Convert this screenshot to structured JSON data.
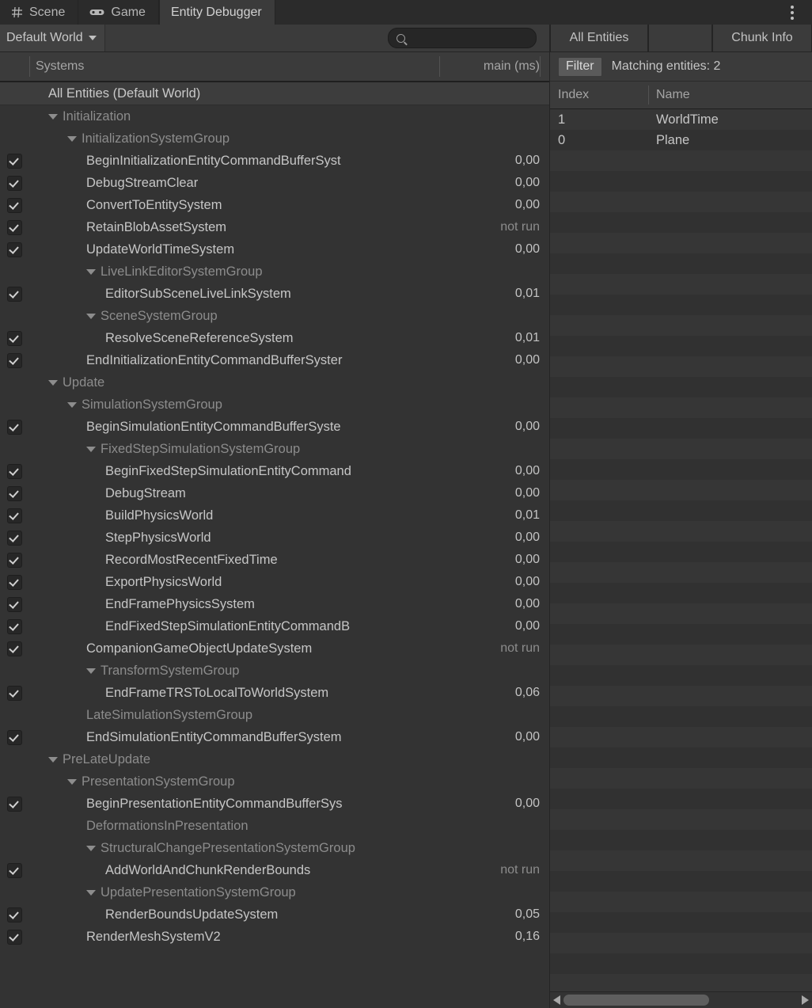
{
  "window": {
    "tabs": [
      {
        "label": "Scene",
        "icon": "grid-icon",
        "active": false
      },
      {
        "label": "Game",
        "icon": "gamepad-icon",
        "active": false
      },
      {
        "label": "Entity Debugger",
        "icon": "none",
        "active": true
      }
    ],
    "menu_icon": "kebab-menu-icon"
  },
  "toolbar": {
    "world_selector": "Default World",
    "world_caret": "chevron-down-icon",
    "search_placeholder": "",
    "search_value": "",
    "search_icon": "search-icon",
    "segments": [
      {
        "label": "All Entities"
      },
      {
        "label": ""
      },
      {
        "label": "Chunk Info"
      }
    ]
  },
  "systems_panel": {
    "columns": {
      "name": "Systems",
      "time": "main (ms)"
    },
    "rows": [
      {
        "indent": 1,
        "label": "All Entities (Default World)",
        "kind": "root",
        "triangle": false,
        "checkbox": false,
        "time": "",
        "highlight": true
      },
      {
        "indent": 1,
        "label": "Initialization",
        "kind": "group",
        "triangle": true,
        "checkbox": false,
        "time": "",
        "highlight": false
      },
      {
        "indent": 2,
        "label": "InitializationSystemGroup",
        "kind": "group",
        "triangle": true,
        "checkbox": false,
        "time": "",
        "highlight": false
      },
      {
        "indent": 3,
        "label": "BeginInitializationEntityCommandBufferSyst",
        "kind": "system",
        "triangle": false,
        "checkbox": true,
        "time": "0,00",
        "highlight": false
      },
      {
        "indent": 3,
        "label": "DebugStreamClear",
        "kind": "system",
        "triangle": false,
        "checkbox": true,
        "time": "0,00",
        "highlight": false
      },
      {
        "indent": 3,
        "label": "ConvertToEntitySystem",
        "kind": "system",
        "triangle": false,
        "checkbox": true,
        "time": "0,00",
        "highlight": false
      },
      {
        "indent": 3,
        "label": "RetainBlobAssetSystem",
        "kind": "system",
        "triangle": false,
        "checkbox": true,
        "time": "not run",
        "highlight": false
      },
      {
        "indent": 3,
        "label": "UpdateWorldTimeSystem",
        "kind": "system",
        "triangle": false,
        "checkbox": true,
        "time": "0,00",
        "highlight": false
      },
      {
        "indent": 3,
        "label": "LiveLinkEditorSystemGroup",
        "kind": "group",
        "triangle": true,
        "checkbox": false,
        "time": "",
        "highlight": false
      },
      {
        "indent": 4,
        "label": "EditorSubSceneLiveLinkSystem",
        "kind": "system",
        "triangle": false,
        "checkbox": true,
        "time": "0,01",
        "highlight": false
      },
      {
        "indent": 3,
        "label": "SceneSystemGroup",
        "kind": "group",
        "triangle": true,
        "checkbox": false,
        "time": "",
        "highlight": false
      },
      {
        "indent": 4,
        "label": "ResolveSceneReferenceSystem",
        "kind": "system",
        "triangle": false,
        "checkbox": true,
        "time": "0,01",
        "highlight": false
      },
      {
        "indent": 3,
        "label": "EndInitializationEntityCommandBufferSyster",
        "kind": "system",
        "triangle": false,
        "checkbox": true,
        "time": "0,00",
        "highlight": false
      },
      {
        "indent": 1,
        "label": "Update",
        "kind": "group",
        "triangle": true,
        "checkbox": false,
        "time": "",
        "highlight": false
      },
      {
        "indent": 2,
        "label": "SimulationSystemGroup",
        "kind": "group",
        "triangle": true,
        "checkbox": false,
        "time": "",
        "highlight": false
      },
      {
        "indent": 3,
        "label": "BeginSimulationEntityCommandBufferSyste",
        "kind": "system",
        "triangle": false,
        "checkbox": true,
        "time": "0,00",
        "highlight": false
      },
      {
        "indent": 3,
        "label": "FixedStepSimulationSystemGroup",
        "kind": "group",
        "triangle": true,
        "checkbox": false,
        "time": "",
        "highlight": false
      },
      {
        "indent": 4,
        "label": "BeginFixedStepSimulationEntityCommand",
        "kind": "system",
        "triangle": false,
        "checkbox": true,
        "time": "0,00",
        "highlight": false
      },
      {
        "indent": 4,
        "label": "DebugStream",
        "kind": "system",
        "triangle": false,
        "checkbox": true,
        "time": "0,00",
        "highlight": false
      },
      {
        "indent": 4,
        "label": "BuildPhysicsWorld",
        "kind": "system",
        "triangle": false,
        "checkbox": true,
        "time": "0,01",
        "highlight": false
      },
      {
        "indent": 4,
        "label": "StepPhysicsWorld",
        "kind": "system",
        "triangle": false,
        "checkbox": true,
        "time": "0,00",
        "highlight": false
      },
      {
        "indent": 4,
        "label": "RecordMostRecentFixedTime",
        "kind": "system",
        "triangle": false,
        "checkbox": true,
        "time": "0,00",
        "highlight": false
      },
      {
        "indent": 4,
        "label": "ExportPhysicsWorld",
        "kind": "system",
        "triangle": false,
        "checkbox": true,
        "time": "0,00",
        "highlight": false
      },
      {
        "indent": 4,
        "label": "EndFramePhysicsSystem",
        "kind": "system",
        "triangle": false,
        "checkbox": true,
        "time": "0,00",
        "highlight": false
      },
      {
        "indent": 4,
        "label": "EndFixedStepSimulationEntityCommandB",
        "kind": "system",
        "triangle": false,
        "checkbox": true,
        "time": "0,00",
        "highlight": false
      },
      {
        "indent": 3,
        "label": "CompanionGameObjectUpdateSystem",
        "kind": "system",
        "triangle": false,
        "checkbox": true,
        "time": "not run",
        "highlight": false
      },
      {
        "indent": 3,
        "label": "TransformSystemGroup",
        "kind": "group",
        "triangle": true,
        "checkbox": false,
        "time": "",
        "highlight": false
      },
      {
        "indent": 4,
        "label": "EndFrameTRSToLocalToWorldSystem",
        "kind": "system",
        "triangle": false,
        "checkbox": true,
        "time": "0,06",
        "highlight": false
      },
      {
        "indent": 3,
        "label": "LateSimulationSystemGroup",
        "kind": "group",
        "triangle": false,
        "checkbox": false,
        "time": "",
        "highlight": false
      },
      {
        "indent": 3,
        "label": "EndSimulationEntityCommandBufferSystem",
        "kind": "system",
        "triangle": false,
        "checkbox": true,
        "time": "0,00",
        "highlight": false
      },
      {
        "indent": 1,
        "label": "PreLateUpdate",
        "kind": "group",
        "triangle": true,
        "checkbox": false,
        "time": "",
        "highlight": false
      },
      {
        "indent": 2,
        "label": "PresentationSystemGroup",
        "kind": "group",
        "triangle": true,
        "checkbox": false,
        "time": "",
        "highlight": false
      },
      {
        "indent": 3,
        "label": "BeginPresentationEntityCommandBufferSys",
        "kind": "system",
        "triangle": false,
        "checkbox": true,
        "time": "0,00",
        "highlight": false
      },
      {
        "indent": 3,
        "label": "DeformationsInPresentation",
        "kind": "group",
        "triangle": false,
        "checkbox": false,
        "time": "",
        "highlight": false
      },
      {
        "indent": 3,
        "label": "StructuralChangePresentationSystemGroup",
        "kind": "group",
        "triangle": true,
        "checkbox": false,
        "time": "",
        "highlight": false
      },
      {
        "indent": 4,
        "label": "AddWorldAndChunkRenderBounds",
        "kind": "system",
        "triangle": false,
        "checkbox": true,
        "time": "not run",
        "highlight": false
      },
      {
        "indent": 3,
        "label": "UpdatePresentationSystemGroup",
        "kind": "group",
        "triangle": true,
        "checkbox": false,
        "time": "",
        "highlight": false
      },
      {
        "indent": 4,
        "label": "RenderBoundsUpdateSystem",
        "kind": "system",
        "triangle": false,
        "checkbox": true,
        "time": "0,05",
        "highlight": false
      },
      {
        "indent": 3,
        "label": "RenderMeshSystemV2",
        "kind": "system",
        "triangle": false,
        "checkbox": true,
        "time": "0,16",
        "highlight": false
      }
    ]
  },
  "entities_panel": {
    "filter_button": "Filter",
    "matching_label": "Matching entities: 2",
    "columns": {
      "index": "Index",
      "name": "Name"
    },
    "rows": [
      {
        "index": "1",
        "name": "WorldTime"
      },
      {
        "index": "0",
        "name": "Plane"
      }
    ],
    "scrollbar": {
      "left_arrow": "arrow-left-icon",
      "right_arrow": "arrow-right-icon"
    }
  }
}
